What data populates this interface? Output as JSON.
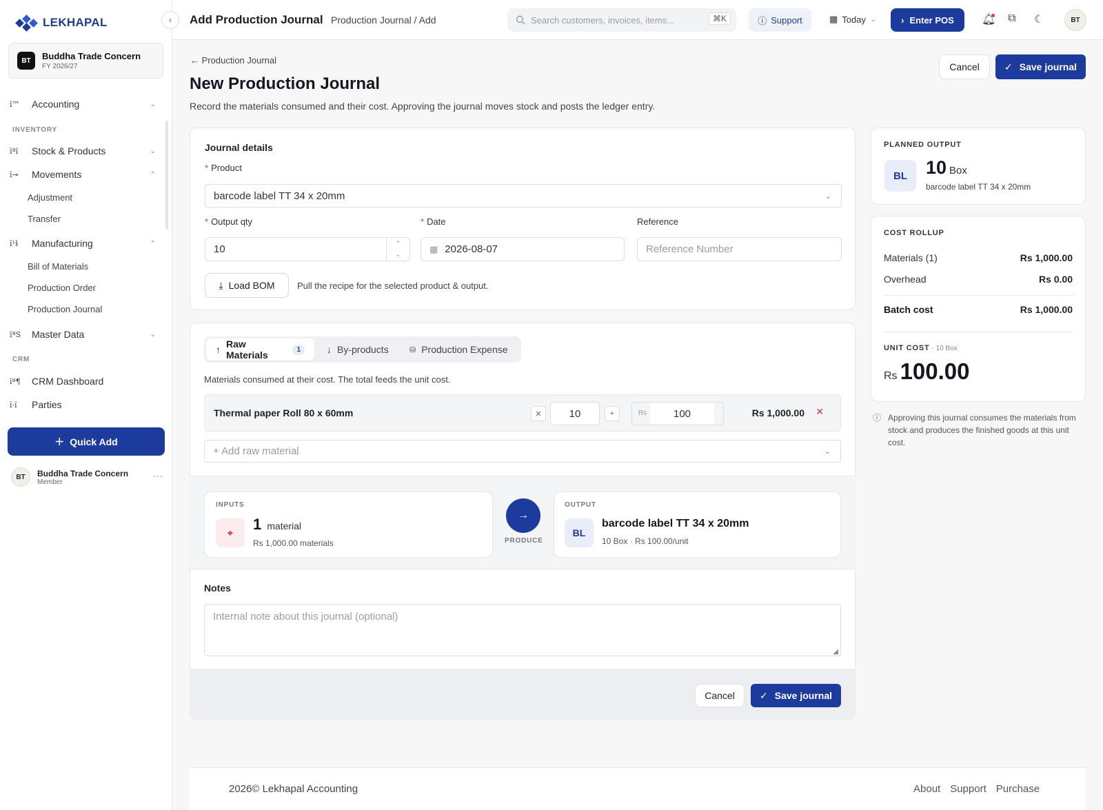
{
  "brand": {
    "name": "LEKHAPAL"
  },
  "org": {
    "initials": "BT",
    "name": "Buddha Trade Concern",
    "fy": "FY 2026/27"
  },
  "sidebar": {
    "accounting": "Accounting",
    "inventory_section": "INVENTORY",
    "stock": "Stock & Products",
    "movements": "Movements",
    "movements_items": [
      "Adjustment",
      "Transfer"
    ],
    "manufacturing": "Manufacturing",
    "manufacturing_items": [
      "Bill of Materials",
      "Production Order",
      "Production Journal"
    ],
    "master_data": "Master Data",
    "crm_section": "CRM",
    "crm_dashboard": "CRM Dashboard",
    "parties": "Parties",
    "quick_add": "Quick Add",
    "user": {
      "initials": "BT",
      "name": "Buddha Trade Concern",
      "role": "Member"
    }
  },
  "topbar": {
    "title": "Add Production Journal",
    "crumb": "Production Journal / Add",
    "search_placeholder": "Search customers, invoices, items...",
    "shortcut": "⌘K",
    "support": "Support",
    "date_filter": "Today",
    "enter_pos": "Enter POS",
    "avatar": "BT"
  },
  "page": {
    "back": "Production Journal",
    "title": "New Production Journal",
    "description": "Record the materials consumed and their cost. Approving the journal moves stock and posts the ledger entry.",
    "cancel": "Cancel",
    "save": "Save journal"
  },
  "details": {
    "heading": "Journal details",
    "product_label": "Product",
    "product_value": "barcode label TT 34 x 20mm",
    "output_qty_label": "Output qty",
    "output_qty_value": "10",
    "date_label": "Date",
    "date_value": "2026-08-07",
    "reference_label": "Reference",
    "reference_placeholder": "Reference Number",
    "load_bom": "Load BOM",
    "load_bom_hint": "Pull the recipe for the selected product & output."
  },
  "tabs": [
    {
      "label": "Raw Materials",
      "count": "1"
    },
    {
      "label": "By-products"
    },
    {
      "label": "Production Expense"
    }
  ],
  "materials": {
    "hint": "Materials consumed at their cost. The total feeds the unit cost.",
    "rows": [
      {
        "name": "Thermal paper Roll 80 x 60mm",
        "qty": "10",
        "currency": "Rs",
        "rate": "100",
        "amount": "Rs 1,000.00"
      }
    ],
    "add_placeholder": "+ Add raw material"
  },
  "flow": {
    "inputs_caption": "INPUTS",
    "inputs_count": "1",
    "inputs_unit": "material",
    "inputs_sub": "Rs 1,000.00 materials",
    "produce": "PRODUCE",
    "output_caption": "OUTPUT",
    "output_initials": "BL",
    "output_name": "barcode label TT 34 x 20mm",
    "output_sub": "10 Box · Rs 100.00/unit"
  },
  "notes": {
    "label": "Notes",
    "placeholder": "Internal note about this journal (optional)"
  },
  "planned": {
    "caption": "PLANNED OUTPUT",
    "initials": "BL",
    "qty": "10",
    "unit": "Box",
    "product": "barcode label TT 34 x 20mm"
  },
  "rollup": {
    "caption": "COST ROLLUP",
    "materials_label": "Materials (1)",
    "materials_value": "Rs 1,000.00",
    "overhead_label": "Overhead",
    "overhead_value": "Rs 0.00",
    "batch_label": "Batch cost",
    "batch_value": "Rs 1,000.00",
    "unit_caption": "UNIT COST",
    "unit_caption_sub": "· 10 Box",
    "unit_currency": "Rs",
    "unit_value": "100.00"
  },
  "info_note": "Approving this journal consumes the materials from stock and produces the finished goods at this unit cost.",
  "footer": {
    "copyright": "2026© Lekhapal Accounting",
    "links": [
      "About",
      "Support",
      "Purchase"
    ]
  }
}
